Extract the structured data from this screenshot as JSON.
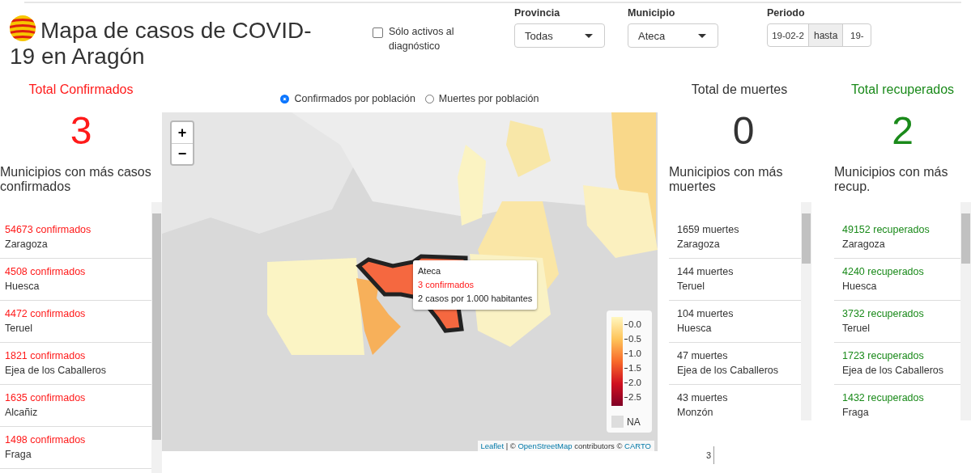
{
  "header": {
    "title": "Mapa de casos de COVID-19 en Aragón",
    "checkbox": {
      "label": "Sólo activos al diagnóstico",
      "checked": false
    },
    "filters": [
      {
        "label": "Provincia",
        "value": "Todas"
      },
      {
        "label": "Municipio",
        "value": "Ateca"
      }
    ],
    "period": {
      "label": "Periodo",
      "from": "19-02-2",
      "separator": "hasta",
      "to": "19-"
    }
  },
  "radios": [
    {
      "label": "Confirmados por población",
      "selected": true
    },
    {
      "label": "Muertes por población",
      "selected": false
    }
  ],
  "panels": [
    {
      "title": "Total Confirmados",
      "total": "3",
      "subtitle": "Municipios con más casos confirmados",
      "color": "#ff1a1a",
      "items": [
        {
          "value": "54673 confirmados",
          "name": "Zaragoza"
        },
        {
          "value": "4508 confirmados",
          "name": "Huesca"
        },
        {
          "value": "4472 confirmados",
          "name": "Teruel"
        },
        {
          "value": "1821 confirmados",
          "name": "Ejea de los Caballeros"
        },
        {
          "value": "1635 confirmados",
          "name": "Alcañiz"
        },
        {
          "value": "1498 confirmados",
          "name": "Fraga"
        }
      ]
    },
    {
      "title": "Total de muertes",
      "total": "0",
      "subtitle": "Municipios con más muertes",
      "color": "#333333",
      "items": [
        {
          "value": "1659 muertes",
          "name": "Zaragoza"
        },
        {
          "value": "144 muertes",
          "name": "Teruel"
        },
        {
          "value": "104 muertes",
          "name": "Huesca"
        },
        {
          "value": "47 muertes",
          "name": "Ejea de los Caballeros"
        },
        {
          "value": "43 muertes",
          "name": "Monzón"
        }
      ]
    },
    {
      "title": "Total recuperados",
      "total": "2",
      "subtitle": "Municipios con más recup.",
      "color": "#1a8a1a",
      "items": [
        {
          "value": "49152 recuperados",
          "name": "Zaragoza"
        },
        {
          "value": "4240 recuperados",
          "name": "Huesca"
        },
        {
          "value": "3732 recuperados",
          "name": "Teruel"
        },
        {
          "value": "1723 recuperados",
          "name": "Ejea de los Caballeros"
        },
        {
          "value": "1432 recuperados",
          "name": "Fraga"
        }
      ]
    }
  ],
  "map": {
    "zoom_in": "+",
    "zoom_out": "−",
    "tooltip": {
      "title": "Ateca",
      "cases": "3 confirmados",
      "rate": "2 casos por 1.000 habitantes"
    },
    "legend_ticks": [
      "0.0",
      "0.5",
      "1.0",
      "1.5",
      "2.0",
      "2.5"
    ],
    "na_label": "NA",
    "attribution": [
      {
        "text": "Leaflet",
        "link": true
      },
      {
        "text": " | © ",
        "link": false
      },
      {
        "text": "OpenStreetMap",
        "link": true
      },
      {
        "text": " contributors © ",
        "link": false
      },
      {
        "text": "CARTO",
        "link": true
      }
    ]
  },
  "chart_stub": {
    "tick": "3"
  }
}
